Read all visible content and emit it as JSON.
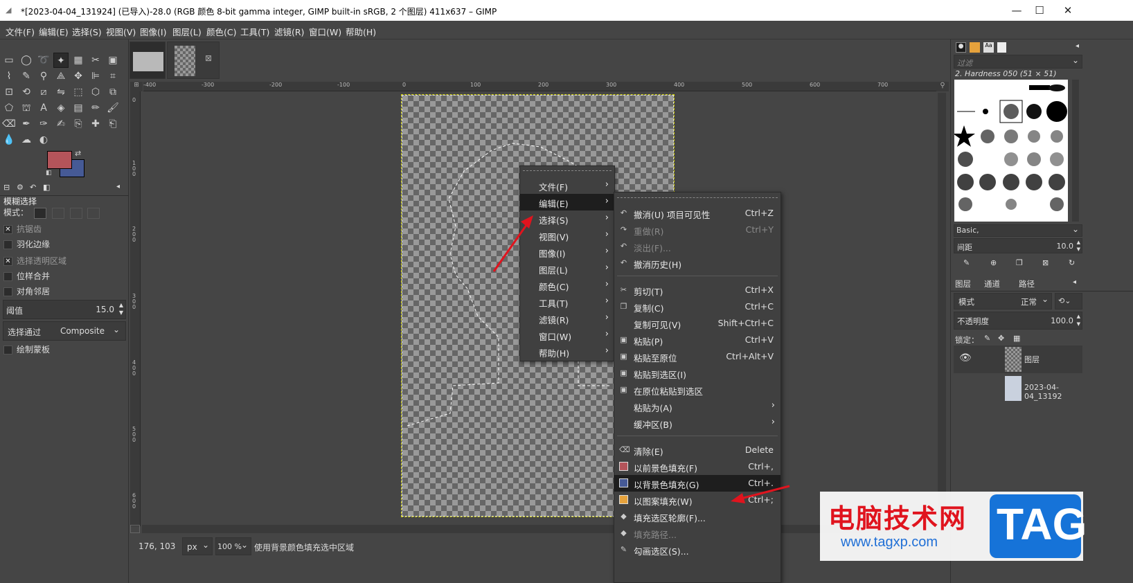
{
  "window": {
    "title": "*[2023-04-04_131924] (已导入)-28.0 (RGB 颜色 8-bit gamma integer, GIMP built-in sRGB, 2 个图层) 411x637 – GIMP",
    "minimize": "—",
    "maximize": "☐",
    "close": "✕"
  },
  "menubar": [
    "文件(F)",
    "编辑(E)",
    "选择(S)",
    "视图(V)",
    "图像(I)",
    "图层(L)",
    "颜色(C)",
    "工具(T)",
    "滤镜(R)",
    "窗口(W)",
    "帮助(H)"
  ],
  "tool_options": {
    "title": "模糊选择",
    "mode_label": "模式：",
    "antialias": "抗锯齿",
    "feather": "羽化边缘",
    "select_transparent": "选择透明区域",
    "sample_merged": "位样合并",
    "diagonal": "对角邻居",
    "threshold_label": "阈值",
    "threshold_value": "15.0",
    "select_by_label": "选择通过",
    "select_by_value": "Composite",
    "draw_mask": "绘制蒙板"
  },
  "rulers": {
    "h": [
      "-400",
      "-300",
      "-200",
      "-100",
      "0",
      "100",
      "200",
      "300",
      "400",
      "500",
      "600",
      "700"
    ],
    "v": [
      "0",
      "1\n0\n0",
      "2\n0\n0",
      "3\n0\n0",
      "4\n0\n0",
      "5\n0\n0",
      "6\n0\n0"
    ]
  },
  "status": {
    "coords": "176, 103",
    "unit": "px",
    "zoom": "100 %",
    "message": "使用背景颜色填充选中区域"
  },
  "main_menu": [
    "文件(F)",
    "编辑(E)",
    "选择(S)",
    "视图(V)",
    "图像(I)",
    "图层(L)",
    "颜色(C)",
    "工具(T)",
    "滤镜(R)",
    "窗口(W)",
    "帮助(H)"
  ],
  "edit_menu": [
    {
      "label": "撤消(U) 项目可见性",
      "shortcut": "Ctrl+Z",
      "icon": "↶"
    },
    {
      "label": "重做(R)",
      "shortcut": "Ctrl+Y",
      "icon": "↷",
      "disabled": true
    },
    {
      "label": "淡出(F)...",
      "shortcut": "",
      "icon": "↶",
      "disabled": true
    },
    {
      "label": "撤消历史(H)",
      "shortcut": "",
      "icon": "↶"
    },
    {
      "label": "剪切(T)",
      "shortcut": "Ctrl+X",
      "icon": "✂"
    },
    {
      "label": "复制(C)",
      "shortcut": "Ctrl+C",
      "icon": "❐"
    },
    {
      "label": "复制可见(V)",
      "shortcut": "Shift+Ctrl+C",
      "icon": ""
    },
    {
      "label": "粘贴(P)",
      "shortcut": "Ctrl+V",
      "icon": "▣"
    },
    {
      "label": "粘贴至原位",
      "shortcut": "Ctrl+Alt+V",
      "icon": "▣"
    },
    {
      "label": "粘贴到选区(I)",
      "shortcut": "",
      "icon": "▣"
    },
    {
      "label": "在原位粘贴到选区",
      "shortcut": "",
      "icon": "▣"
    },
    {
      "label": "粘贴为(A)",
      "shortcut": "",
      "icon": "",
      "submenu": true
    },
    {
      "label": "缓冲区(B)",
      "shortcut": "",
      "icon": "",
      "submenu": true
    },
    {
      "label": "清除(E)",
      "shortcut": "Delete",
      "icon": "⌫"
    },
    {
      "label": "以前景色填充(F)",
      "shortcut": "Ctrl+,",
      "icon": "fg"
    },
    {
      "label": "以背景色填充(G)",
      "shortcut": "Ctrl+.",
      "icon": "bg",
      "highlight": true
    },
    {
      "label": "以图案填充(W)",
      "shortcut": "Ctrl+;",
      "icon": "pat"
    },
    {
      "label": "填充选区轮廓(F)...",
      "shortcut": "",
      "icon": "◆"
    },
    {
      "label": "填充路径...",
      "shortcut": "",
      "icon": "◆",
      "disabled": true
    },
    {
      "label": "勾画选区(S)...",
      "shortcut": "",
      "icon": "✎"
    }
  ],
  "brushes": {
    "filter_placeholder": "过滤",
    "brush_name": "2. Hardness 050 (51 × 51)",
    "tag": "Basic,",
    "spacing_label": "间距",
    "spacing_value": "10.0"
  },
  "layers": {
    "tabs": [
      "图层",
      "通道",
      "路径"
    ],
    "mode_label": "模式",
    "mode_value": "正常",
    "opacity_label": "不透明度",
    "opacity_value": "100.0",
    "lock_label": "锁定：",
    "items": [
      "图层",
      "2023-04-04_13192"
    ]
  },
  "watermark": {
    "text": "电脑技术网",
    "url": "www.tagxp.com",
    "logo": "TAG"
  },
  "colors": {
    "fg": "#b4545a",
    "bg": "#465a96",
    "menu_highlight": "#1e1e1e"
  }
}
